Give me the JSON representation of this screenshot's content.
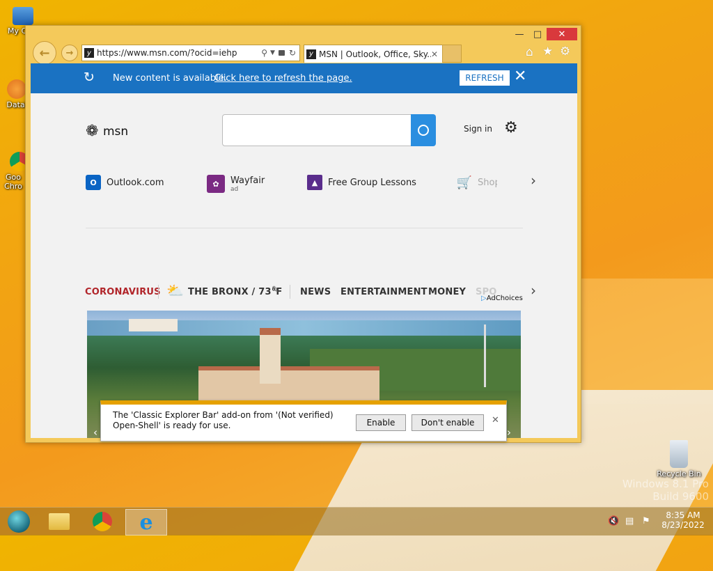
{
  "desktop": {
    "icons": [
      {
        "label": "My Co"
      },
      {
        "label": "DataW"
      },
      {
        "label": "Goo Chro"
      },
      {
        "label": "Recycle Bin"
      }
    ],
    "watermark": {
      "line1": "Windows 8.1 Pro",
      "line2": "Build 9600"
    }
  },
  "browser": {
    "address": "https://www.msn.com/?ocid=iehp",
    "tab_title": "MSN | Outlook, Office, Sky...",
    "favicon_glyph": "y"
  },
  "notice": {
    "text": "New content is available.",
    "link": "Click here to refresh the page.",
    "refresh_label": "REFRESH"
  },
  "msn": {
    "logo": "msn",
    "signin": "Sign in",
    "quicklinks": [
      {
        "label": "Outlook.com",
        "sub": "",
        "icon": "outlook-icon",
        "color": "#0a64c4"
      },
      {
        "label": "Wayfair",
        "sub": "ad",
        "icon": "wayfair-icon",
        "color": "#7b2a83"
      },
      {
        "label": "Free Group Lessons",
        "sub": "",
        "icon": "graduation-cap-icon",
        "color": "#5a2d8c"
      },
      {
        "label": "Shop",
        "sub": "",
        "icon": "cart-icon",
        "color": "#2a8ee0"
      }
    ],
    "adchoices": "AdChoices",
    "nav": {
      "coronavirus": "CORONAVIRUS",
      "weather": "THE BRONX / 73°F",
      "news": "NEWS",
      "entertainment": "ENTERTAINMENT",
      "money": "MONEY",
      "sports": "SPO"
    }
  },
  "addon_bar": {
    "message_line1": "The 'Classic Explorer Bar' add-on from '(Not verified)",
    "message_line2": "Open-Shell' is ready for use.",
    "enable": "Enable",
    "dont_enable": "Don't enable"
  },
  "taskbar": {
    "time": "8:35 AM",
    "date": "8/23/2022"
  }
}
